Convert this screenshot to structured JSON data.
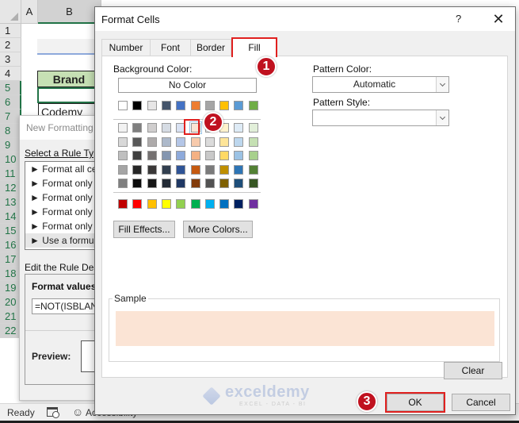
{
  "spreadsheet": {
    "columns": [
      "A",
      "B"
    ],
    "rows": [
      "1",
      "2",
      "3",
      "4",
      "5",
      "6",
      "7",
      "8",
      "9",
      "10",
      "11",
      "12",
      "13",
      "14",
      "15",
      "16",
      "17",
      "18",
      "19",
      "20",
      "21",
      "22"
    ],
    "selected_rows": [
      "5",
      "6",
      "7",
      "8",
      "9",
      "10",
      "11",
      "12",
      "13",
      "14",
      "15",
      "16",
      "17",
      "18",
      "19",
      "20",
      "21",
      "22"
    ],
    "cells": {
      "B4": "Brand",
      "B6": "Codemy"
    }
  },
  "new_formatting_rule": {
    "title": "New Formatting Rule",
    "select_rule_type_label": "Select a Rule Type:",
    "rule_types": [
      "► Format all cells based on their values",
      "► Format only cells that contain",
      "► Format only top or bottom ranked values",
      "► Format only values that are above or below average",
      "► Format only unique or duplicate values",
      "► Use a formula to determine which cells to format"
    ],
    "selected_rule_index": 5,
    "edit_desc_label": "Edit the Rule Description:",
    "format_values_label": "Format values where this formula is true:",
    "formula": "=NOT(ISBLANK(",
    "preview_label": "Preview:"
  },
  "statusbar": {
    "ready": "Ready",
    "accessibility": "Accessibility"
  },
  "format_cells": {
    "title": "Format Cells",
    "help": "?",
    "close": "✕",
    "tabs": [
      {
        "label": "Number",
        "active": false
      },
      {
        "label": "Font",
        "active": false
      },
      {
        "label": "Border",
        "active": false
      },
      {
        "label": "Fill",
        "active": true
      }
    ],
    "background_color_label": "Background Color:",
    "no_color_label": "No Color",
    "theme_colors_top": [
      "#ffffff",
      "#000000",
      "#e7e6e6",
      "#44546a",
      "#4472c4",
      "#ed7d31",
      "#a5a5a5",
      "#ffc000",
      "#5b9bd5",
      "#70ad47"
    ],
    "theme_color_tints": [
      [
        "#f2f2f2",
        "#7f7f7f",
        "#d0cece",
        "#d6dce4",
        "#d9e2f3",
        "#fbe4d5",
        "#ededed",
        "#fff2cc",
        "#deebf6",
        "#e2efd9"
      ],
      [
        "#d8d8d8",
        "#595959",
        "#aeabab",
        "#adb9ca",
        "#b4c6e7",
        "#f7caac",
        "#dbdbdb",
        "#fee599",
        "#bdd7ee",
        "#c5e0b3"
      ],
      [
        "#bfbfbf",
        "#3f3f3f",
        "#757171",
        "#8496b0",
        "#8eaadb",
        "#f4b183",
        "#c9c9c9",
        "#ffd965",
        "#9cc3e5",
        "#a8d08d"
      ],
      [
        "#a5a5a5",
        "#262626",
        "#3a3838",
        "#323f4f",
        "#2f5496",
        "#c55a11",
        "#7b7b7b",
        "#bf8f00",
        "#2e75b5",
        "#538135"
      ],
      [
        "#7f7f7f",
        "#0c0c0c",
        "#161616",
        "#222a35",
        "#1f3864",
        "#833c0b",
        "#525252",
        "#7f6000",
        "#1e4e79",
        "#375623"
      ]
    ],
    "standard_colors": [
      "#c00000",
      "#ff0000",
      "#ffc000",
      "#ffff00",
      "#92d050",
      "#00b050",
      "#00b0f0",
      "#0070c0",
      "#002060",
      "#7030a0"
    ],
    "selected_color": "#fbe4d5",
    "fill_effects_label": "Fill Effects...",
    "more_colors_label": "More Colors...",
    "pattern_color_label": "Pattern Color:",
    "pattern_color_value": "Automatic",
    "pattern_style_label": "Pattern Style:",
    "pattern_style_value": "",
    "sample_label": "Sample",
    "clear_label": "Clear",
    "ok_label": "OK",
    "cancel_label": "Cancel"
  },
  "annotations": {
    "step1": "1",
    "step2": "2",
    "step3": "3"
  },
  "watermark": {
    "name": "exceldemy",
    "tagline": "EXCEL - DATA - BI"
  }
}
